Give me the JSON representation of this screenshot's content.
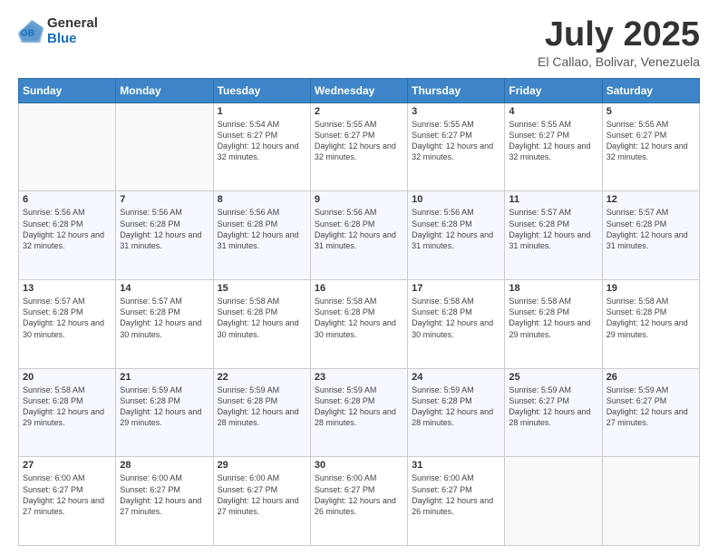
{
  "logo": {
    "general": "General",
    "blue": "Blue"
  },
  "header": {
    "title": "July 2025",
    "location": "El Callao, Bolivar, Venezuela"
  },
  "weekdays": [
    "Sunday",
    "Monday",
    "Tuesday",
    "Wednesday",
    "Thursday",
    "Friday",
    "Saturday"
  ],
  "weeks": [
    [
      {
        "day": "",
        "sunrise": "",
        "sunset": "",
        "daylight": ""
      },
      {
        "day": "",
        "sunrise": "",
        "sunset": "",
        "daylight": ""
      },
      {
        "day": "1",
        "sunrise": "Sunrise: 5:54 AM",
        "sunset": "Sunset: 6:27 PM",
        "daylight": "Daylight: 12 hours and 32 minutes."
      },
      {
        "day": "2",
        "sunrise": "Sunrise: 5:55 AM",
        "sunset": "Sunset: 6:27 PM",
        "daylight": "Daylight: 12 hours and 32 minutes."
      },
      {
        "day": "3",
        "sunrise": "Sunrise: 5:55 AM",
        "sunset": "Sunset: 6:27 PM",
        "daylight": "Daylight: 12 hours and 32 minutes."
      },
      {
        "day": "4",
        "sunrise": "Sunrise: 5:55 AM",
        "sunset": "Sunset: 6:27 PM",
        "daylight": "Daylight: 12 hours and 32 minutes."
      },
      {
        "day": "5",
        "sunrise": "Sunrise: 5:55 AM",
        "sunset": "Sunset: 6:27 PM",
        "daylight": "Daylight: 12 hours and 32 minutes."
      }
    ],
    [
      {
        "day": "6",
        "sunrise": "Sunrise: 5:56 AM",
        "sunset": "Sunset: 6:28 PM",
        "daylight": "Daylight: 12 hours and 32 minutes."
      },
      {
        "day": "7",
        "sunrise": "Sunrise: 5:56 AM",
        "sunset": "Sunset: 6:28 PM",
        "daylight": "Daylight: 12 hours and 31 minutes."
      },
      {
        "day": "8",
        "sunrise": "Sunrise: 5:56 AM",
        "sunset": "Sunset: 6:28 PM",
        "daylight": "Daylight: 12 hours and 31 minutes."
      },
      {
        "day": "9",
        "sunrise": "Sunrise: 5:56 AM",
        "sunset": "Sunset: 6:28 PM",
        "daylight": "Daylight: 12 hours and 31 minutes."
      },
      {
        "day": "10",
        "sunrise": "Sunrise: 5:56 AM",
        "sunset": "Sunset: 6:28 PM",
        "daylight": "Daylight: 12 hours and 31 minutes."
      },
      {
        "day": "11",
        "sunrise": "Sunrise: 5:57 AM",
        "sunset": "Sunset: 6:28 PM",
        "daylight": "Daylight: 12 hours and 31 minutes."
      },
      {
        "day": "12",
        "sunrise": "Sunrise: 5:57 AM",
        "sunset": "Sunset: 6:28 PM",
        "daylight": "Daylight: 12 hours and 31 minutes."
      }
    ],
    [
      {
        "day": "13",
        "sunrise": "Sunrise: 5:57 AM",
        "sunset": "Sunset: 6:28 PM",
        "daylight": "Daylight: 12 hours and 30 minutes."
      },
      {
        "day": "14",
        "sunrise": "Sunrise: 5:57 AM",
        "sunset": "Sunset: 6:28 PM",
        "daylight": "Daylight: 12 hours and 30 minutes."
      },
      {
        "day": "15",
        "sunrise": "Sunrise: 5:58 AM",
        "sunset": "Sunset: 6:28 PM",
        "daylight": "Daylight: 12 hours and 30 minutes."
      },
      {
        "day": "16",
        "sunrise": "Sunrise: 5:58 AM",
        "sunset": "Sunset: 6:28 PM",
        "daylight": "Daylight: 12 hours and 30 minutes."
      },
      {
        "day": "17",
        "sunrise": "Sunrise: 5:58 AM",
        "sunset": "Sunset: 6:28 PM",
        "daylight": "Daylight: 12 hours and 30 minutes."
      },
      {
        "day": "18",
        "sunrise": "Sunrise: 5:58 AM",
        "sunset": "Sunset: 6:28 PM",
        "daylight": "Daylight: 12 hours and 29 minutes."
      },
      {
        "day": "19",
        "sunrise": "Sunrise: 5:58 AM",
        "sunset": "Sunset: 6:28 PM",
        "daylight": "Daylight: 12 hours and 29 minutes."
      }
    ],
    [
      {
        "day": "20",
        "sunrise": "Sunrise: 5:58 AM",
        "sunset": "Sunset: 6:28 PM",
        "daylight": "Daylight: 12 hours and 29 minutes."
      },
      {
        "day": "21",
        "sunrise": "Sunrise: 5:59 AM",
        "sunset": "Sunset: 6:28 PM",
        "daylight": "Daylight: 12 hours and 29 minutes."
      },
      {
        "day": "22",
        "sunrise": "Sunrise: 5:59 AM",
        "sunset": "Sunset: 6:28 PM",
        "daylight": "Daylight: 12 hours and 28 minutes."
      },
      {
        "day": "23",
        "sunrise": "Sunrise: 5:59 AM",
        "sunset": "Sunset: 6:28 PM",
        "daylight": "Daylight: 12 hours and 28 minutes."
      },
      {
        "day": "24",
        "sunrise": "Sunrise: 5:59 AM",
        "sunset": "Sunset: 6:28 PM",
        "daylight": "Daylight: 12 hours and 28 minutes."
      },
      {
        "day": "25",
        "sunrise": "Sunrise: 5:59 AM",
        "sunset": "Sunset: 6:27 PM",
        "daylight": "Daylight: 12 hours and 28 minutes."
      },
      {
        "day": "26",
        "sunrise": "Sunrise: 5:59 AM",
        "sunset": "Sunset: 6:27 PM",
        "daylight": "Daylight: 12 hours and 27 minutes."
      }
    ],
    [
      {
        "day": "27",
        "sunrise": "Sunrise: 6:00 AM",
        "sunset": "Sunset: 6:27 PM",
        "daylight": "Daylight: 12 hours and 27 minutes."
      },
      {
        "day": "28",
        "sunrise": "Sunrise: 6:00 AM",
        "sunset": "Sunset: 6:27 PM",
        "daylight": "Daylight: 12 hours and 27 minutes."
      },
      {
        "day": "29",
        "sunrise": "Sunrise: 6:00 AM",
        "sunset": "Sunset: 6:27 PM",
        "daylight": "Daylight: 12 hours and 27 minutes."
      },
      {
        "day": "30",
        "sunrise": "Sunrise: 6:00 AM",
        "sunset": "Sunset: 6:27 PM",
        "daylight": "Daylight: 12 hours and 26 minutes."
      },
      {
        "day": "31",
        "sunrise": "Sunrise: 6:00 AM",
        "sunset": "Sunset: 6:27 PM",
        "daylight": "Daylight: 12 hours and 26 minutes."
      },
      {
        "day": "",
        "sunrise": "",
        "sunset": "",
        "daylight": ""
      },
      {
        "day": "",
        "sunrise": "",
        "sunset": "",
        "daylight": ""
      }
    ]
  ]
}
